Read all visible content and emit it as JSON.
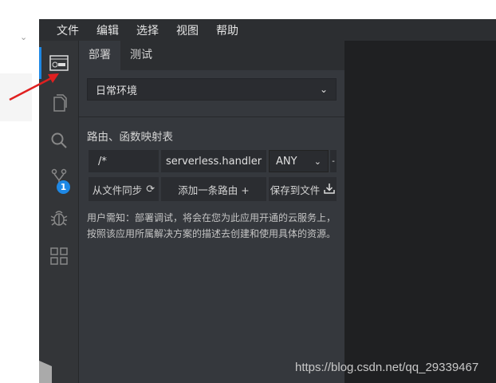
{
  "menu": [
    "文件",
    "编辑",
    "选择",
    "视图",
    "帮助"
  ],
  "tabs": {
    "deploy": "部署",
    "test": "测试"
  },
  "env_select": {
    "value": "日常环境"
  },
  "section_title": "路由、函数映射表",
  "route": {
    "path": "/*",
    "handler": "serverless.handler",
    "method": "ANY"
  },
  "buttons": {
    "sync": "从文件同步",
    "add": "添加一条路由 +",
    "save": "保存到文件"
  },
  "notice": [
    "用户需知：部署调试，将会在您为此应用开通的云服务上，",
    "按照该应用所属解决方案的描述去创建和使用具体的资源。"
  ],
  "badge": "1",
  "watermark": "https://blog.csdn.net/qq_29339467",
  "colors": {
    "accent": "#1e88e5",
    "arrow": "#e02020"
  }
}
